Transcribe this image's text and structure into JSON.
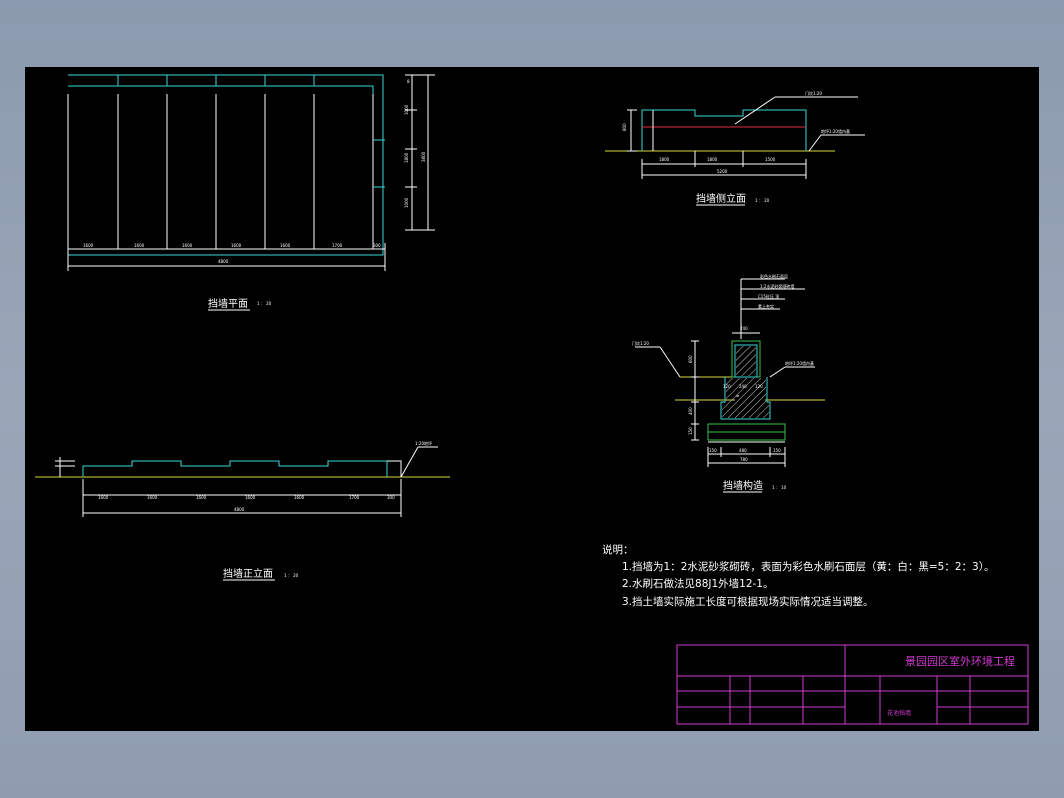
{
  "views": {
    "plan_title": "挡墙平面",
    "front_title": "挡墙正立面",
    "side_title": "挡墙侧立面",
    "section_title": "挡墙构造"
  },
  "notes": {
    "heading": "说明：",
    "items": [
      "1.挡墙为1：2水泥砂浆砌砖，表面为彩色水刷石面层（黄：白：黑=5：2：3）。",
      "2.水刷石做法见88J1外墙12-1。",
      "3.挡土墙实际施工长度可根据现场实际情况适当调整。"
    ]
  },
  "title_block": {
    "project_name": "景园园区室外环境工程",
    "drawing_name": "花池挡墙"
  },
  "colors": {
    "background": "#000000",
    "frame": "#d23ad2",
    "wall": "#3ad7d7",
    "ground": "#d8d83a",
    "footing": "#36c24a",
    "callout": "#e0303a",
    "line": "#ffffff"
  }
}
